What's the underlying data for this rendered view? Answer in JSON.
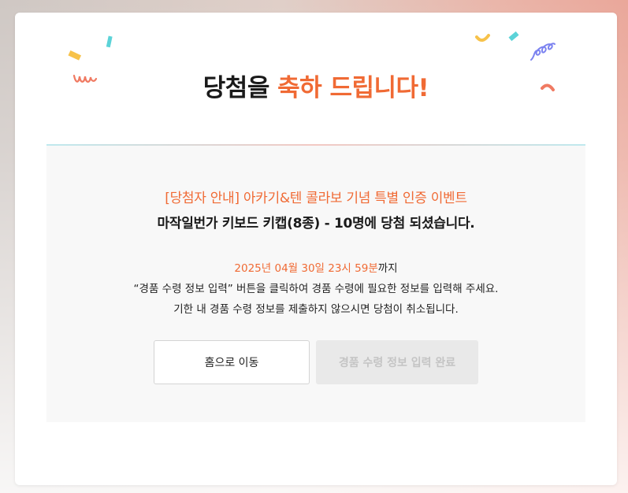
{
  "header": {
    "title_prefix": "당첨을 ",
    "title_accent": "축하 드립니다!"
  },
  "notice": {
    "event_title": "[당첨자 안내] 아카기&텐 콜라보 기념 특별 인증 이벤트",
    "win_text": "마작일번가 키보드 키캡(8종) - 10명에 당첨 되셨습니다.",
    "deadline_date": "2025년 04월 30일 23시 59분",
    "deadline_suffix": "까지",
    "info_line1": "“경품 수령 정보 입력” 버튼을 클릭하여 경품 수령에 필요한 정보를 입력해 주세요.",
    "info_line2": "기한 내 경품 수령 정보를 제출하지 않으시면 당첨이 취소됩니다."
  },
  "buttons": {
    "home_label": "홈으로 이동",
    "complete_label": "경품 수령 정보 입력 완료"
  },
  "colors": {
    "accent": "#f06a34",
    "confetti_yellow": "#f7c24a",
    "confetti_teal": "#5cd3d8",
    "confetti_coral": "#f07a62",
    "confetti_purple": "#7c83f0"
  }
}
